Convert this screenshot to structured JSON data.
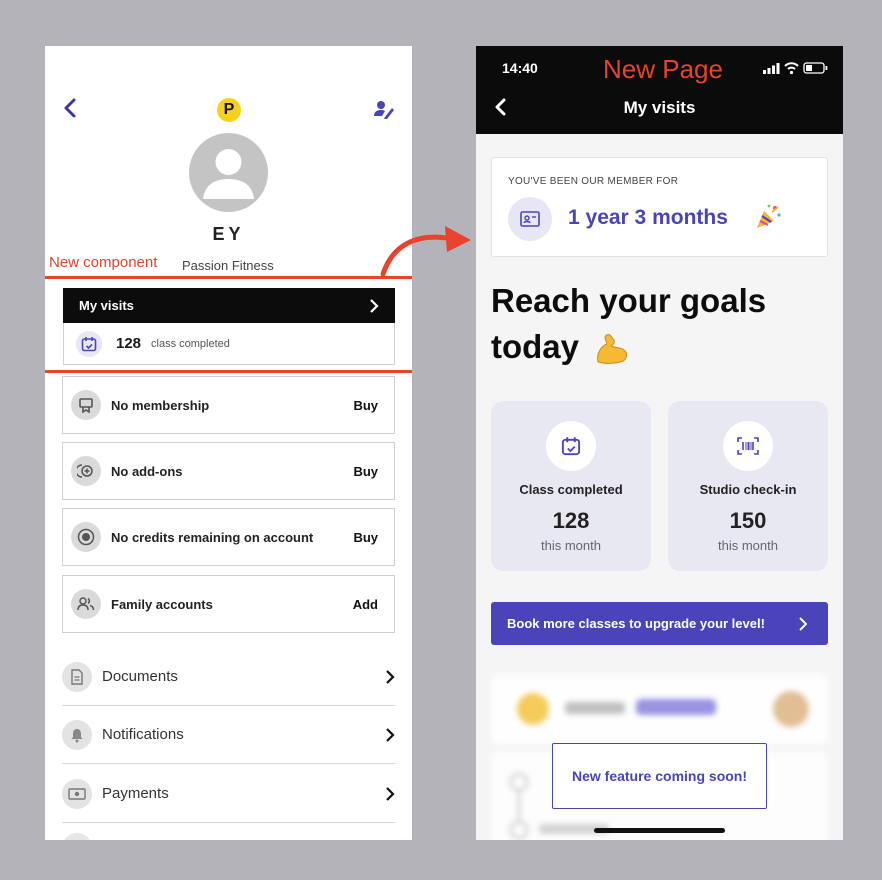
{
  "left": {
    "logo_letter": "P",
    "initials": "EY",
    "annotation": "New component",
    "studio": "Passion Fitness",
    "my_visits": {
      "title": "My visits",
      "count": "128",
      "label": "class completed"
    },
    "cards": [
      {
        "label": "No membership",
        "action": "Buy",
        "icon": "membership-icon"
      },
      {
        "label": "No add-ons",
        "action": "Buy",
        "icon": "add-ons-icon"
      },
      {
        "label": "No credits remaining on account",
        "action": "Buy",
        "icon": "credits-icon"
      },
      {
        "label": "Family accounts",
        "action": "Add",
        "icon": "family-icon"
      }
    ],
    "menu": [
      {
        "label": "Documents",
        "icon": "document-icon"
      },
      {
        "label": "Notifications",
        "icon": "bell-icon"
      },
      {
        "label": "Payments",
        "icon": "payment-icon"
      }
    ]
  },
  "right": {
    "time": "14:40",
    "annotation": "New Page",
    "title": "My visits",
    "member": {
      "label": "YOU'VE BEEN OUR MEMBER FOR",
      "value": "1 year 3 months"
    },
    "goals_line1": "Reach your goals",
    "goals_line2": "today",
    "stats": [
      {
        "label": "Class completed",
        "value": "128",
        "sub": "this month",
        "icon": "calendar-check-icon"
      },
      {
        "label": "Studio check-in",
        "value": "150",
        "sub": "this month",
        "icon": "barcode-scan-icon"
      }
    ],
    "book_button": "Book more classes to upgrade your level!",
    "feature_box": "New feature coming soon!"
  },
  "colors": {
    "accent": "#4b44b8",
    "annotation": "#e5432e",
    "dark": "#0b0b0b",
    "stat_bg": "#e8e8f3"
  }
}
